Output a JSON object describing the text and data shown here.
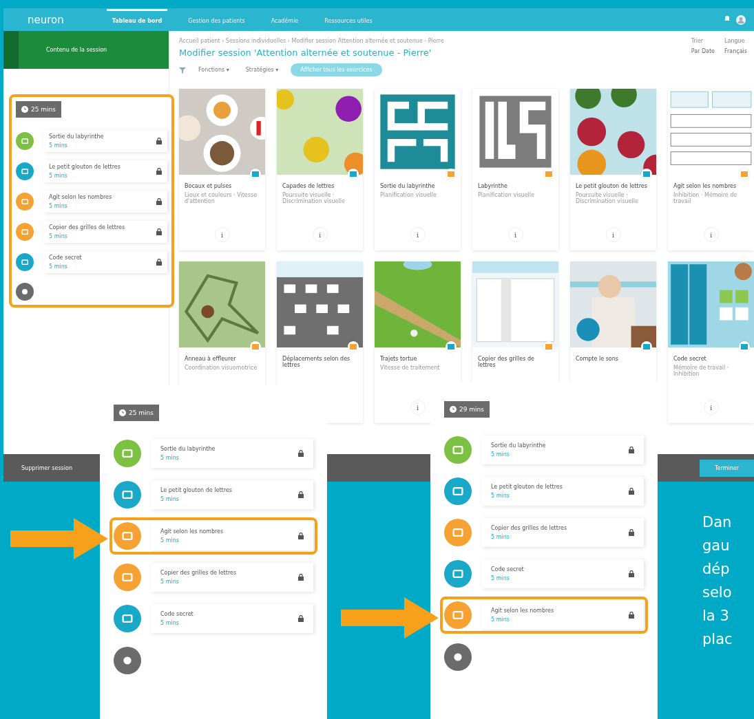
{
  "app": {
    "logo": "neuron",
    "nav": [
      {
        "label": "Tableau de bord",
        "selected": true
      },
      {
        "label": "Gestion des patients",
        "selected": false
      },
      {
        "label": "Académie",
        "selected": false
      },
      {
        "label": "Ressources utiles",
        "selected": false
      }
    ],
    "sidebar_button": "Contenu de la session",
    "breadcrumb": "Accueil patient › Sessions individuelles › Modifier session Attention alternée et soutenue - Pierre",
    "title": "Modifier session 'Attention alternée et soutenue - Pierre'",
    "filters": [
      "Fonctions ▾",
      "Stratégies ▾"
    ],
    "filter_button": "Afficher tous les exercices",
    "selects": [
      {
        "label": "Trier",
        "value": "Par Date"
      },
      {
        "label": "Langue",
        "value": "Français"
      }
    ],
    "session": {
      "duration": "25 mins",
      "items": [
        {
          "name": "Sortie du labyrinthe",
          "time": "5 mins",
          "color": "#7dc142"
        },
        {
          "name": "Le petit glouton de lettres",
          "time": "5 mins",
          "color": "#19a8c8"
        },
        {
          "name": "Agit selon les nombres",
          "time": "5 mins",
          "color": "#f5a233"
        },
        {
          "name": "Copier des grilles de lettres",
          "time": "5 mins",
          "color": "#f5a233"
        },
        {
          "name": "Code secret",
          "time": "5 mins",
          "color": "#19a8c8"
        }
      ]
    },
    "cards": [
      {
        "title": "Bocaux et pulses",
        "description": "Lieux et couleurs · Vitesse d'attention",
        "color": "#19a8c8",
        "info": "i"
      },
      {
        "title": "Capades de lettres",
        "description": "Poursuite visuelle · Discrimination visuelle",
        "color": "#19a8c8",
        "info": "i"
      },
      {
        "title": "Sortie du labyrinthe",
        "description": "Planification visuelle",
        "color": "#f5a233",
        "info": "i"
      },
      {
        "title": "Labyrinthe",
        "description": "Planification visuelle",
        "color": "#f5a233",
        "info": "i"
      },
      {
        "title": "Le petit glouton de lettres",
        "description": "Poursuite visuelle · Discrimination visuelle",
        "color": "#19a8c8",
        "info": "i"
      },
      {
        "title": "Agit selon les nombres",
        "description": "Inhibition · Mémoire de travail",
        "color": "#f5a233",
        "info": "i"
      },
      {
        "title": "Anneau à effleurer",
        "description": "Coordination visuomotrice",
        "color": "#f5a233"
      },
      {
        "title": "Déplacements selon des lettres",
        "color": "#f5a233"
      },
      {
        "title": "Trajets tortue",
        "description": "Vitesse de traitement",
        "color": "#19a8c8",
        "info": "i"
      },
      {
        "title": "Copier des grilles de lettres",
        "color": "#f5a233"
      },
      {
        "title": "Compte le sons",
        "color": "#19a8c8"
      },
      {
        "title": "Code secret",
        "description": "Mémoire de travail · Inhibition",
        "color": "#19a8c8",
        "info": "i"
      }
    ],
    "footer": {
      "delete": "Supprimer session",
      "save": "Terminer"
    }
  },
  "panels": [
    {
      "duration": "25 mins",
      "items": [
        {
          "name": "Sortie du labyrinthe",
          "time": "5 mins",
          "color": "#7dc142",
          "highlighted": false
        },
        {
          "name": "Le petit glouton de lettres",
          "time": "5 mins",
          "color": "#19a8c8",
          "highlighted": false
        },
        {
          "name": "Agit selon les nombres",
          "time": "5 mins",
          "color": "#f5a233",
          "highlighted": true
        },
        {
          "name": "Copier des grilles de lettres",
          "time": "5 mins",
          "color": "#f5a233",
          "highlighted": false
        },
        {
          "name": "Code secret",
          "time": "5 mins",
          "color": "#19a8c8",
          "highlighted": false
        }
      ]
    },
    {
      "duration": "29 mins",
      "items": [
        {
          "name": "Sortie du labyrinthe",
          "time": "5 mins",
          "color": "#7dc142",
          "highlighted": false
        },
        {
          "name": "Le petit glouton de lettres",
          "time": "5 mins",
          "color": "#19a8c8",
          "highlighted": false
        },
        {
          "name": "Copier des grilles de lettres",
          "time": "5 mins",
          "color": "#f5a233",
          "highlighted": false
        },
        {
          "name": "Code secret",
          "time": "5 mins",
          "color": "#19a8c8",
          "highlighted": false
        },
        {
          "name": "Agit selon les nombres",
          "time": "5 mins",
          "color": "#f5a233",
          "highlighted": true
        }
      ]
    }
  ],
  "caption_lines": [
    "Dan",
    "gau",
    "dép",
    "selo",
    "la 3",
    "plac"
  ]
}
